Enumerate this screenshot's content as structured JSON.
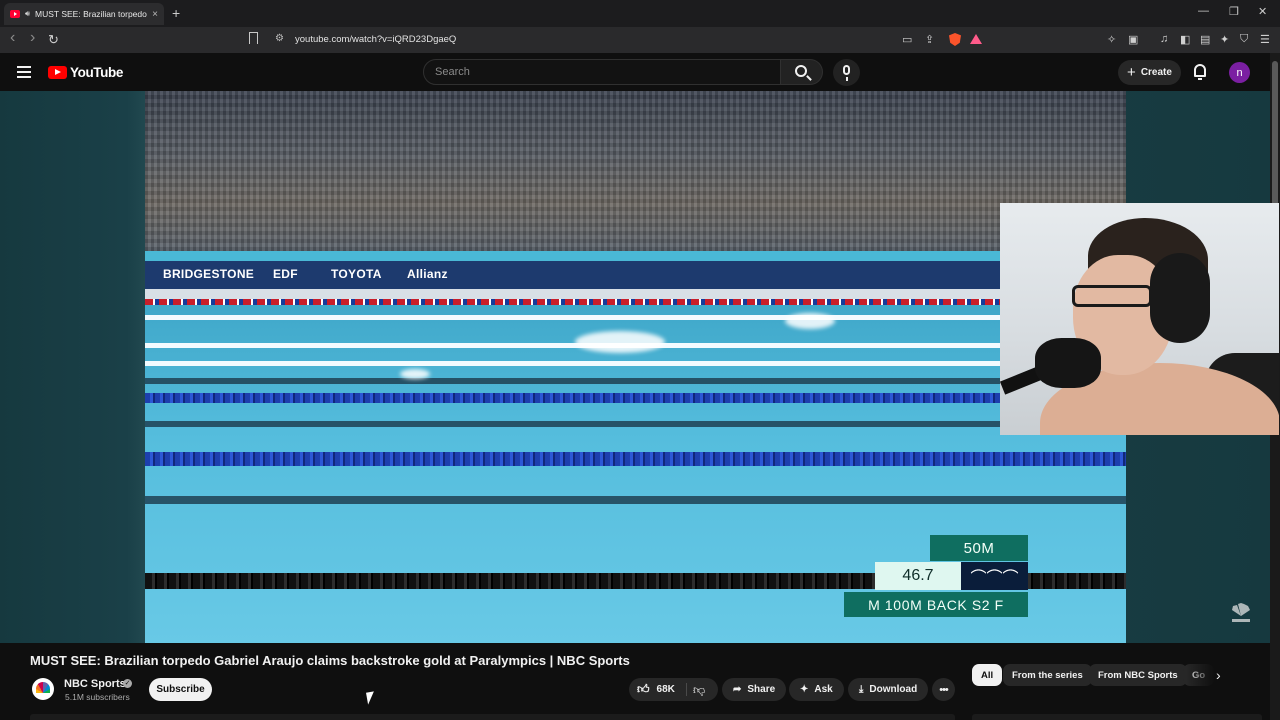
{
  "browser": {
    "tab_title": "MUST SEE: Brazilian torpedo",
    "tab_close": "×",
    "new_tab": "+",
    "url": "youtube.com/watch?v=iQRD23DgaeQ",
    "window_controls": {
      "minimize": "—",
      "restore": "❐",
      "close": "✕"
    },
    "nav": {
      "back": "‹",
      "forward": "›",
      "reload": "↻"
    }
  },
  "header": {
    "logo_text": "YouTube",
    "search_placeholder": "Search",
    "create_label": "Create",
    "create_plus": "+",
    "avatar_initial": "n"
  },
  "video": {
    "sponsors": [
      "BRIDGESTONE",
      "EDF",
      "TOYOTA",
      "Allianz"
    ],
    "scoreboard": {
      "distance": "50M",
      "time": "46.7",
      "emblem": "⌒⌒⌒",
      "event": "M 100M BACK S2 F"
    }
  },
  "details": {
    "title": "MUST SEE: Brazilian torpedo Gabriel Araujo claims backstroke gold at Paralympics | NBC Sports",
    "channel_name": "NBC Sports",
    "verified_mark": "✓",
    "subscribers": "5.1M subscribers",
    "subscribe_label": "Subscribe",
    "likes": "68K",
    "share_label": "Share",
    "ask_label": "Ask",
    "download_label": "Download",
    "more_label": "•••"
  },
  "chips": [
    {
      "label": "All",
      "active": true
    },
    {
      "label": "From the series",
      "active": false
    },
    {
      "label": "From NBC Sports",
      "active": false
    },
    {
      "label": "Go",
      "active": false
    }
  ],
  "icons": {
    "thumbs_up": "👍︎",
    "thumbs_down": "👎︎",
    "share": "➦",
    "ask": "✦",
    "download": "⤓",
    "chevron_right": "›"
  }
}
